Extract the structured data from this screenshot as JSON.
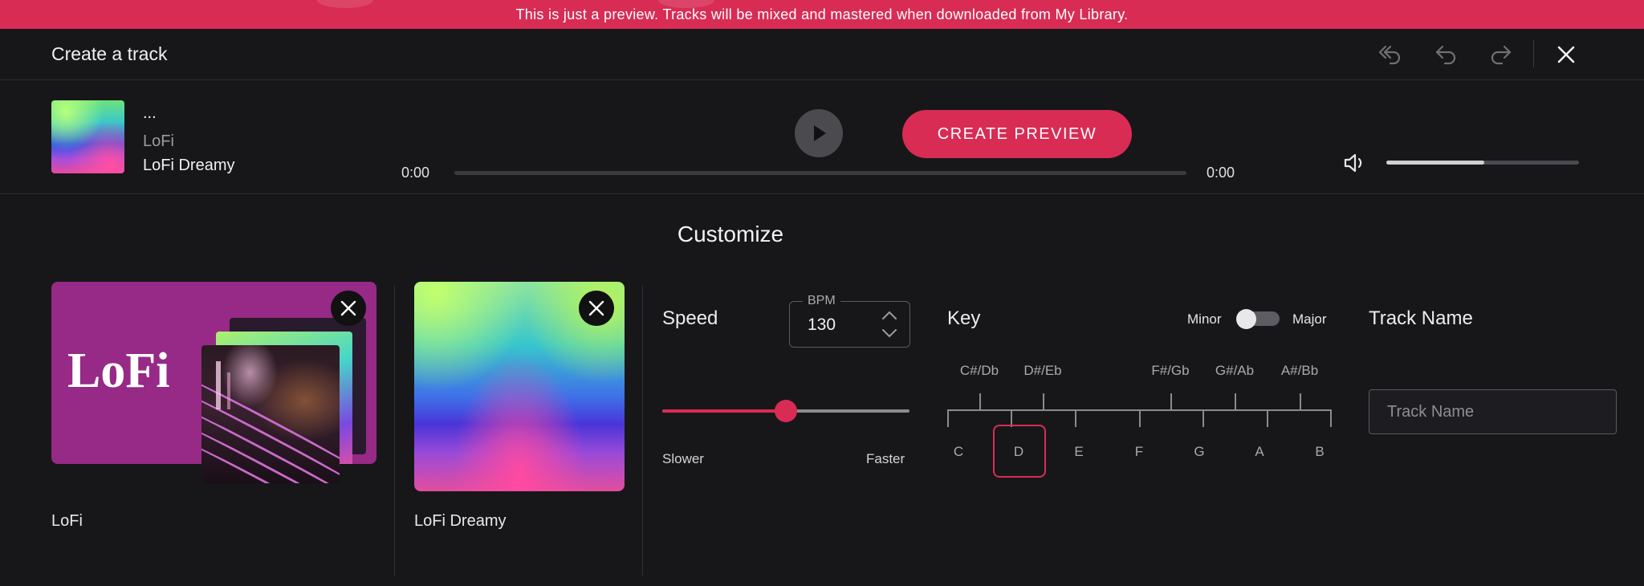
{
  "banner": {
    "text": "This is just a preview. Tracks will be mixed and mastered when downloaded from My Library."
  },
  "header": {
    "title": "Create a track",
    "icons": [
      "undo-all-icon",
      "undo-icon",
      "redo-icon",
      "close-icon"
    ]
  },
  "player": {
    "track_title": "...",
    "genre": "LoFi",
    "style": "LoFi Dreamy",
    "time_elapsed": "0:00",
    "time_total": "0:00",
    "progress": 0,
    "volume": 0.51,
    "create_label": "CREATE PREVIEW"
  },
  "customize": {
    "heading": "Customize",
    "genre_card": {
      "art_text": "LoFi",
      "label": "LoFi"
    },
    "style_card": {
      "label": "LoFi Dreamy"
    },
    "speed": {
      "label": "Speed",
      "bpm_legend": "BPM",
      "bpm_value": "130",
      "slider_value": 0.5,
      "slower_label": "Slower",
      "faster_label": "Faster"
    },
    "key": {
      "label": "Key",
      "minor_label": "Minor",
      "major_label": "Major",
      "mode": "Minor",
      "sharps": [
        "C#/Db",
        "D#/Eb",
        "F#/Gb",
        "G#/Ab",
        "A#/Bb"
      ],
      "naturals": [
        "C",
        "D",
        "E",
        "F",
        "G",
        "A",
        "B"
      ],
      "selected": "D"
    },
    "track_name": {
      "label": "Track Name",
      "placeholder": "Track Name",
      "value": ""
    }
  },
  "colors": {
    "accent": "#d82c54",
    "background": "#17171a"
  }
}
